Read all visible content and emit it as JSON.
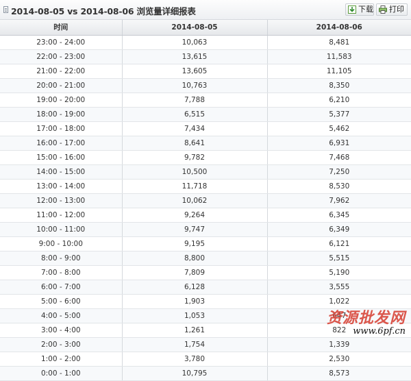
{
  "header": {
    "title": "2014-08-05 vs 2014-08-06 浏览量详细报表",
    "download_label": "下载",
    "print_label": "打印"
  },
  "table": {
    "columns": [
      "时间",
      "2014-08-05",
      "2014-08-06"
    ],
    "rows": [
      [
        "23:00 - 24:00",
        "10,063",
        "8,481"
      ],
      [
        "22:00 - 23:00",
        "13,615",
        "11,583"
      ],
      [
        "21:00 - 22:00",
        "13,605",
        "11,105"
      ],
      [
        "20:00 - 21:00",
        "10,763",
        "8,350"
      ],
      [
        "19:00 - 20:00",
        "7,788",
        "6,210"
      ],
      [
        "18:00 - 19:00",
        "6,515",
        "5,377"
      ],
      [
        "17:00 - 18:00",
        "7,434",
        "5,462"
      ],
      [
        "16:00 - 17:00",
        "8,641",
        "6,931"
      ],
      [
        "15:00 - 16:00",
        "9,782",
        "7,468"
      ],
      [
        "14:00 - 15:00",
        "10,500",
        "7,250"
      ],
      [
        "13:00 - 14:00",
        "11,718",
        "8,530"
      ],
      [
        "12:00 - 13:00",
        "10,062",
        "7,962"
      ],
      [
        "11:00 - 12:00",
        "9,264",
        "6,345"
      ],
      [
        "10:00 - 11:00",
        "9,747",
        "6,349"
      ],
      [
        "9:00 - 10:00",
        "9,195",
        "6,121"
      ],
      [
        "8:00 - 9:00",
        "8,800",
        "5,515"
      ],
      [
        "7:00 - 8:00",
        "7,809",
        "5,190"
      ],
      [
        "6:00 - 7:00",
        "6,128",
        "3,555"
      ],
      [
        "5:00 - 6:00",
        "1,903",
        "1,022"
      ],
      [
        "4:00 - 5:00",
        "1,053",
        "647"
      ],
      [
        "3:00 - 4:00",
        "1,261",
        "822"
      ],
      [
        "2:00 - 3:00",
        "1,754",
        "1,339"
      ],
      [
        "1:00 - 2:00",
        "3,780",
        "2,530"
      ],
      [
        "0:00 - 1:00",
        "10,795",
        "8,573"
      ]
    ]
  },
  "watermark": {
    "text": "资源批发网",
    "url": "www.6pf.cn"
  },
  "colors": {
    "header_bg": "#eef0f3",
    "row_alt": "#f7f9fb",
    "watermark_red": "#d9463a"
  }
}
